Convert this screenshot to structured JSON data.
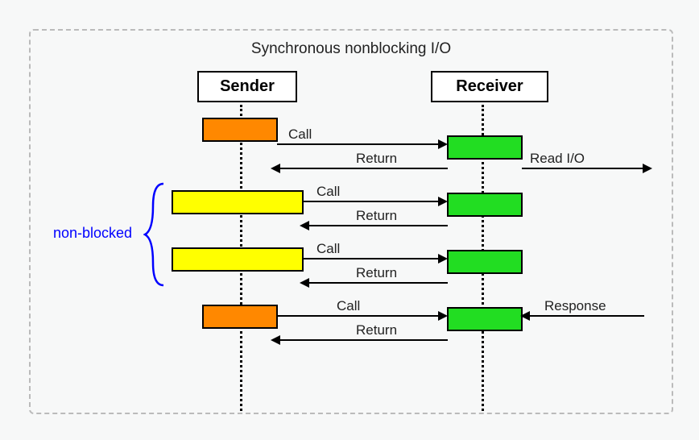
{
  "title": "Synchronous nonblocking I/O",
  "actors": {
    "sender": "Sender",
    "receiver": "Receiver"
  },
  "arrows": {
    "call1": "Call",
    "return1": "Return",
    "readio": "Read I/O",
    "call2": "Call",
    "return2": "Return",
    "call3": "Call",
    "return3": "Return",
    "call4": "Call",
    "return4": "Return",
    "response": "Response"
  },
  "annotation": {
    "nonblocked": "non-blocked"
  }
}
